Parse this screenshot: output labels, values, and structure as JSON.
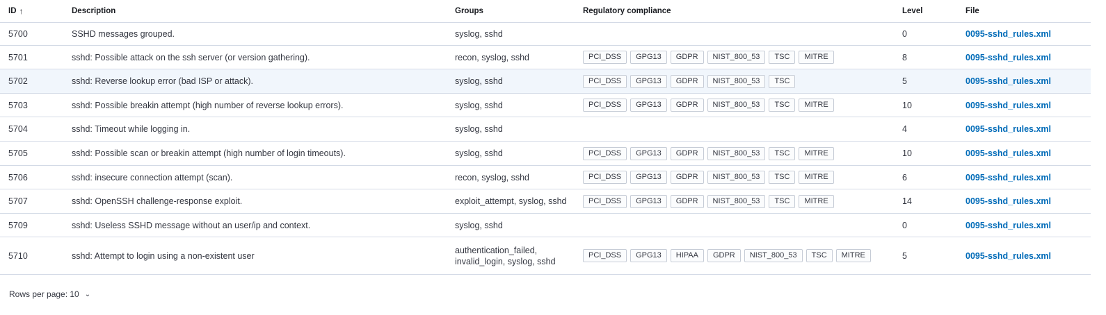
{
  "columns": {
    "id": "ID",
    "description": "Description",
    "groups": "Groups",
    "compliance": "Regulatory compliance",
    "level": "Level",
    "file": "File"
  },
  "sort_icon": "arrow-up-icon",
  "rows": [
    {
      "id": "5700",
      "description": "SSHD messages grouped.",
      "groups": "syslog, sshd",
      "compliance": [],
      "level": "0",
      "file": "0095-sshd_rules.xml"
    },
    {
      "id": "5701",
      "description": "sshd: Possible attack on the ssh server (or version gathering).",
      "groups": "recon, syslog, sshd",
      "compliance": [
        "PCI_DSS",
        "GPG13",
        "GDPR",
        "NIST_800_53",
        "TSC",
        "MITRE"
      ],
      "level": "8",
      "file": "0095-sshd_rules.xml"
    },
    {
      "id": "5702",
      "description": "sshd: Reverse lookup error (bad ISP or attack).",
      "groups": "syslog, sshd",
      "compliance": [
        "PCI_DSS",
        "GPG13",
        "GDPR",
        "NIST_800_53",
        "TSC"
      ],
      "level": "5",
      "file": "0095-sshd_rules.xml"
    },
    {
      "id": "5703",
      "description": "sshd: Possible breakin attempt (high number of reverse lookup errors).",
      "groups": "syslog, sshd",
      "compliance": [
        "PCI_DSS",
        "GPG13",
        "GDPR",
        "NIST_800_53",
        "TSC",
        "MITRE"
      ],
      "level": "10",
      "file": "0095-sshd_rules.xml"
    },
    {
      "id": "5704",
      "description": "sshd: Timeout while logging in.",
      "groups": "syslog, sshd",
      "compliance": [],
      "level": "4",
      "file": "0095-sshd_rules.xml"
    },
    {
      "id": "5705",
      "description": "sshd: Possible scan or breakin attempt (high number of login timeouts).",
      "groups": "syslog, sshd",
      "compliance": [
        "PCI_DSS",
        "GPG13",
        "GDPR",
        "NIST_800_53",
        "TSC",
        "MITRE"
      ],
      "level": "10",
      "file": "0095-sshd_rules.xml"
    },
    {
      "id": "5706",
      "description": "sshd: insecure connection attempt (scan).",
      "groups": "recon, syslog, sshd",
      "compliance": [
        "PCI_DSS",
        "GPG13",
        "GDPR",
        "NIST_800_53",
        "TSC",
        "MITRE"
      ],
      "level": "6",
      "file": "0095-sshd_rules.xml"
    },
    {
      "id": "5707",
      "description": "sshd: OpenSSH challenge-response exploit.",
      "groups": "exploit_attempt, syslog, sshd",
      "compliance": [
        "PCI_DSS",
        "GPG13",
        "GDPR",
        "NIST_800_53",
        "TSC",
        "MITRE"
      ],
      "level": "14",
      "file": "0095-sshd_rules.xml"
    },
    {
      "id": "5709",
      "description": "sshd: Useless SSHD message without an user/ip and context.",
      "groups": "syslog, sshd",
      "compliance": [],
      "level": "0",
      "file": "0095-sshd_rules.xml"
    },
    {
      "id": "5710",
      "description": "sshd: Attempt to login using a non-existent user",
      "groups": "authentication_failed, invalid_login, syslog, sshd",
      "compliance": [
        "PCI_DSS",
        "GPG13",
        "HIPAA",
        "GDPR",
        "NIST_800_53",
        "TSC",
        "MITRE"
      ],
      "level": "5",
      "file": "0095-sshd_rules.xml"
    }
  ],
  "pagination": {
    "rows_per_page_label": "Rows per page: 10",
    "icon": "chevron-down-icon"
  },
  "colors": {
    "link": "#006bb8",
    "border": "#d3dae6",
    "highlight_row": "#f1f6fc"
  }
}
